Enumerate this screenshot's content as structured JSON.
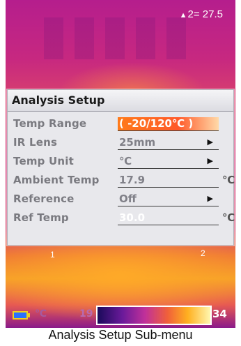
{
  "readout": {
    "marker": "▲",
    "label": "2=",
    "value": "27.5"
  },
  "markers": {
    "one": "1",
    "two": "2"
  },
  "menu": {
    "title": "Analysis Setup",
    "rows": [
      {
        "label": "Temp Range",
        "value": "( -20/120℃ )",
        "highlighted": true
      },
      {
        "label": "IR Lens",
        "value": "25mm",
        "arrow": "▶"
      },
      {
        "label": "Temp Unit",
        "value": "℃",
        "arrow": "▶"
      },
      {
        "label": "Ambient Temp",
        "value": "17.9",
        "unit": "℃"
      },
      {
        "label": "Reference",
        "value": "Off",
        "arrow": "▶"
      },
      {
        "label": "Ref Temp",
        "value": "30.0",
        "unit": "℃"
      }
    ]
  },
  "status": {
    "unit": "℃",
    "scale_min": "19",
    "scale_max": "34"
  },
  "caption": "Analysis Setup Sub-menu",
  "colors": {
    "accent": "#ff6a1a",
    "menu_bg": "#e8e8ec",
    "battery": "#2a70ff"
  }
}
